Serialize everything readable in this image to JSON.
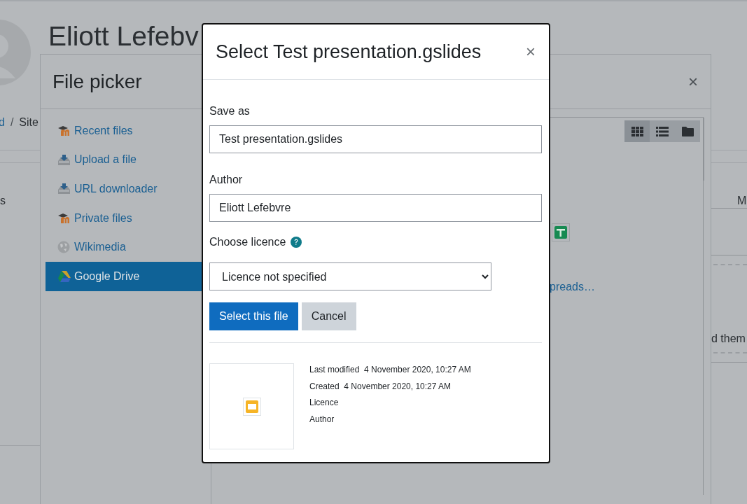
{
  "background_page": {
    "heading": "Eliott Lefebv",
    "breadcrumb": [
      {
        "label": "d",
        "kind": "link"
      },
      {
        "label": "Site",
        "kind": "current"
      }
    ],
    "breadcrumb_separator": "/",
    "fragments": [
      "s",
      "M",
      "d them"
    ]
  },
  "file_picker": {
    "title": "File picker",
    "close": "×",
    "repositories": [
      {
        "label": "Recent files",
        "kind": "moodle",
        "selected": false
      },
      {
        "label": "Upload a file",
        "kind": "upload",
        "selected": false
      },
      {
        "label": "URL downloader",
        "kind": "upload",
        "selected": false
      },
      {
        "label": "Private files",
        "kind": "moodle",
        "selected": false
      },
      {
        "label": "Wikimedia",
        "kind": "globe",
        "selected": false
      },
      {
        "label": "Google Drive",
        "kind": "drive",
        "selected": true
      }
    ],
    "view_modes": [
      {
        "kind": "icons",
        "selected": true
      },
      {
        "kind": "list",
        "selected": false
      },
      {
        "kind": "tree",
        "selected": false
      }
    ],
    "file_link": "preads…"
  },
  "dialog": {
    "title": "Select Test presentation.gslides",
    "close": "×",
    "fields": [
      {
        "label": "Save as",
        "value": "Test presentation.gslides"
      },
      {
        "label": "Author",
        "value": "Eliott Lefebvre"
      }
    ],
    "licence": {
      "label": "Choose licence",
      "value": "Licence not specified"
    },
    "buttons": [
      {
        "label": "Select this file",
        "kind": "primary"
      },
      {
        "label": "Cancel",
        "kind": "secondary"
      }
    ],
    "details": [
      {
        "label": "Last modified",
        "value": "4 November 2020, 10:27 AM"
      },
      {
        "label": "Created",
        "value": "4 November 2020, 10:27 AM"
      },
      {
        "label": "Licence"
      },
      {
        "label": "Author"
      }
    ]
  }
}
